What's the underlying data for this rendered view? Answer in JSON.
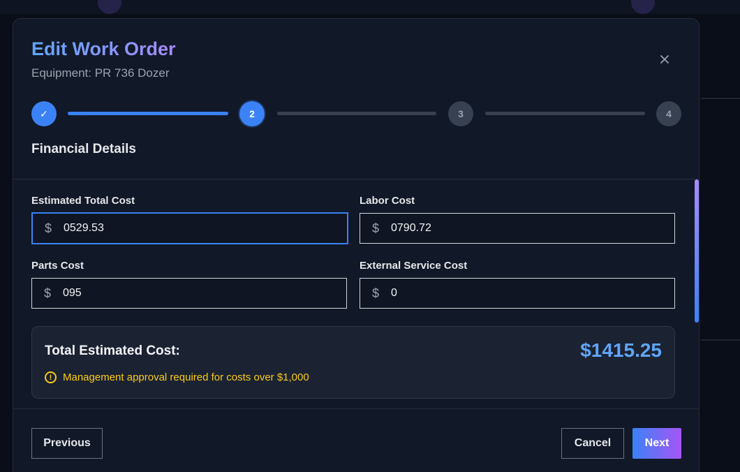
{
  "modal": {
    "title": "Edit Work Order",
    "subtitle": "Equipment: PR 736 Dozer",
    "close_icon": "close-icon"
  },
  "stepper": {
    "steps": [
      {
        "label": "✓",
        "state": "done"
      },
      {
        "label": "2",
        "state": "active"
      },
      {
        "label": "3",
        "state": "todo"
      },
      {
        "label": "4",
        "state": "todo"
      }
    ]
  },
  "section": {
    "title": "Financial Details"
  },
  "fields": {
    "estimated_total": {
      "label": "Estimated Total Cost",
      "currency": "$",
      "value": "0529.53"
    },
    "labor": {
      "label": "Labor Cost",
      "currency": "$",
      "value": "0790.72"
    },
    "parts": {
      "label": "Parts Cost",
      "currency": "$",
      "value": "095"
    },
    "external": {
      "label": "External Service Cost",
      "currency": "$",
      "value": "0"
    }
  },
  "summary": {
    "label": "Total Estimated Cost:",
    "value": "$1415.25",
    "warning": "Management approval required for costs over $1,000",
    "warning_icon": "alert-circle-icon"
  },
  "footer": {
    "previous_label": "Previous",
    "cancel_label": "Cancel",
    "next_label": "Next"
  },
  "colors": {
    "accent": "#3b82f6",
    "accent_purple": "#a78bfa",
    "warning": "#facc15",
    "total_value": "#60a5fa"
  }
}
